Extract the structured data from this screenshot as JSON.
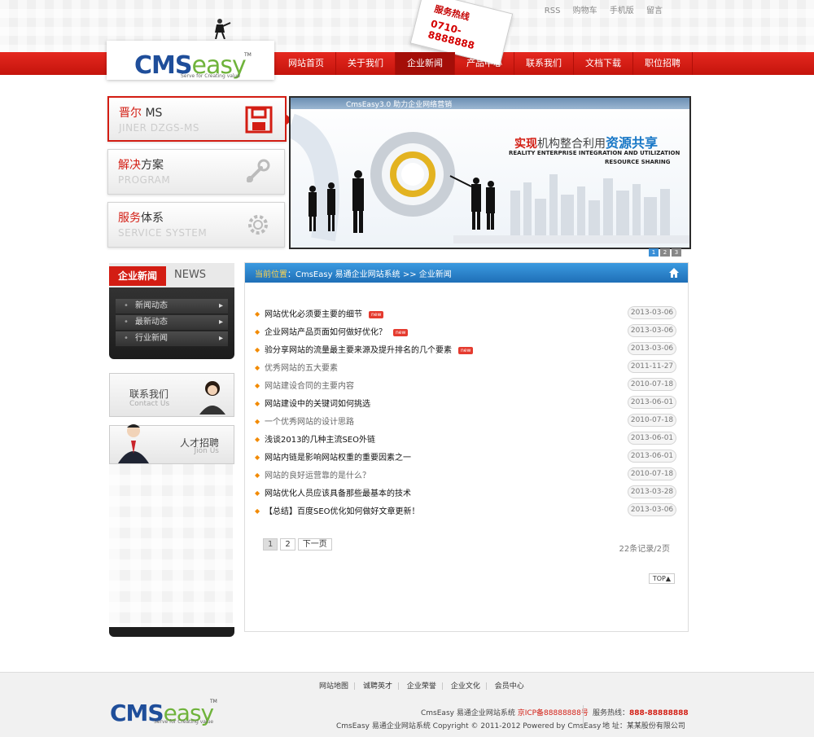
{
  "top_links": [
    "RSS",
    "购物车",
    "手机版",
    "留言"
  ],
  "hotline_card": {
    "label": "服务热线",
    "number": "0710-8888888"
  },
  "logo": {
    "cms": "CMS",
    "easy": "easy",
    "tagline": "Serve for Creating value",
    "tm": "TM"
  },
  "nav": [
    {
      "label": "网站首页"
    },
    {
      "label": "关于我们"
    },
    {
      "label": "企业新闻",
      "active": true
    },
    {
      "label": "产品中心"
    },
    {
      "label": "联系我们"
    },
    {
      "label": "文档下载"
    },
    {
      "label": "职位招聘"
    }
  ],
  "side_buttons": [
    {
      "cn_red": "晋尔",
      "cn_rest": " MS",
      "en": "JINER DZGS-MS",
      "icon": "floppy-disk-icon"
    },
    {
      "cn_red": "解决",
      "cn_rest": "方案",
      "en": "PROGRAM",
      "icon": "wrench-icon"
    },
    {
      "cn_red": "服务",
      "cn_rest": "体系",
      "en": "SERVICE SYSTEM",
      "icon": "gear-icon"
    }
  ],
  "banner": {
    "header": "CmsEasy3.0 助力企业网络营销",
    "cn_red": "实现",
    "cn_mid": "机构整合利用",
    "cn_blue": "资源共享",
    "en_line1": "REALITY ENTERPRISE INTEGRATION AND UTILIZATION",
    "en_line2": "RESOURCE SHARING",
    "dots": [
      "1",
      "2",
      "3"
    ]
  },
  "left_news": {
    "tab_active": "企业新闻",
    "tab_en": "NEWS",
    "items": [
      "新闻动态",
      "最新动态",
      "行业新闻"
    ]
  },
  "contact_box": {
    "cn": "联系我们",
    "en": "Contact Us"
  },
  "jobs_box": {
    "cn": "人才招聘",
    "en": "Jion Us"
  },
  "breadcrumb": {
    "prefix": "当前位置",
    "path": "：CmsEasy 易通企业网站系统  >>  企业新闻"
  },
  "articles": [
    {
      "title": "网站优化必须要主要的细节",
      "date": "2013-03-06",
      "new": true,
      "style": "dark"
    },
    {
      "title": "企业网站产品页面如何做好优化？",
      "date": "2013-03-06",
      "new": true,
      "style": "dark"
    },
    {
      "title": "验分享网站的流量最主要来源及提升排名的几个要素",
      "date": "2013-03-06",
      "new": true,
      "style": "dark"
    },
    {
      "title": "优秀网站的五大要素",
      "date": "2011-11-27",
      "new": false,
      "style": "gray"
    },
    {
      "title": "网站建设合同的主要内容",
      "date": "2010-07-18",
      "new": false,
      "style": "gray"
    },
    {
      "title": "网站建设中的关键词如何挑选",
      "date": "2013-06-01",
      "new": false,
      "style": "dark"
    },
    {
      "title": "一个优秀网站的设计思路",
      "date": "2010-07-18",
      "new": false,
      "style": "gray"
    },
    {
      "title": "浅谈2013的几种主流SEO外链",
      "date": "2013-06-01",
      "new": false,
      "style": "dark"
    },
    {
      "title": "网站内链是影响网站权重的重要因素之一",
      "date": "2013-06-01",
      "new": false,
      "style": "dark"
    },
    {
      "title": "网站的良好运营靠的是什么？",
      "date": "2010-07-18",
      "new": false,
      "style": "gray"
    },
    {
      "title": "网站优化人员应该具备那些最基本的技术",
      "date": "2013-03-28",
      "new": false,
      "style": "dark"
    },
    {
      "title": "【总结】百度SEO优化如何做好文章更新！",
      "date": "2013-03-06",
      "new": false,
      "style": "dark"
    }
  ],
  "new_badge": "new",
  "pager": {
    "pages": [
      "1",
      "2"
    ],
    "next": "下一页",
    "summary": "22条记录/2页"
  },
  "top_button": "TOP▲",
  "footer": {
    "links": [
      "网站地图",
      "诚聘英才",
      "企业荣誉",
      "企业文化",
      "会员中心"
    ],
    "line1_text": "CmsEasy 易通企业网站系统 ",
    "line1_icp": "京ICP备88888888号",
    "line2": "CmsEasy 易通企业网站系统 Copyright © 2011-2012 Powered by CmsEasy",
    "hotline_label": "服务热线：",
    "hotline_number": "888-88888888",
    "address": "地  址：某某股份有限公司"
  },
  "colors": {
    "brand_red": "#d31d13",
    "nav_red": "#e5281f",
    "crumb_blue": "#1f6fb7",
    "bullet_orange": "#f28a00"
  }
}
